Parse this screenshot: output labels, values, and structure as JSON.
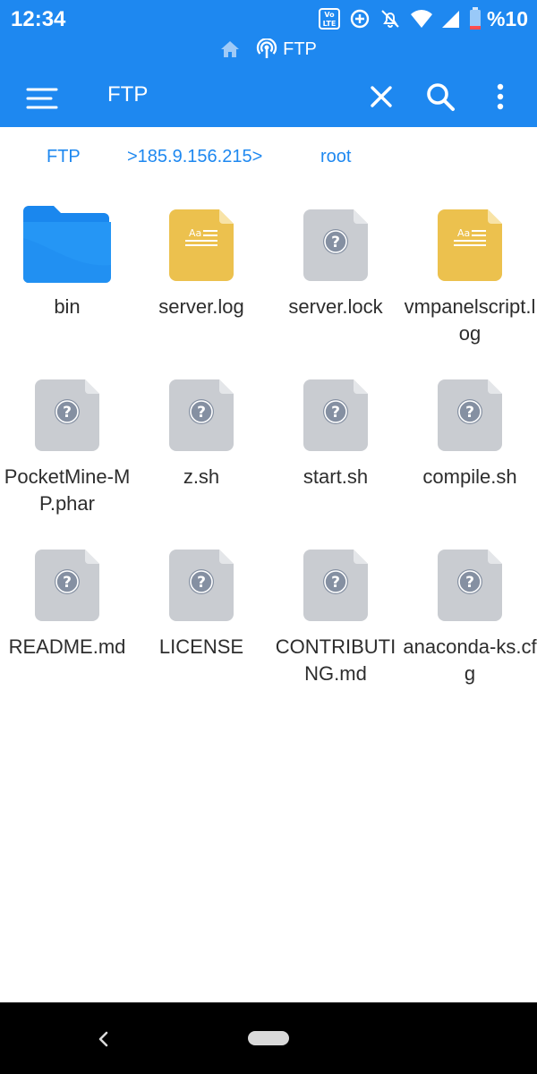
{
  "status_bar": {
    "time": "12:34",
    "battery_text": "%10",
    "sub_label": "FTP"
  },
  "app_bar": {
    "title": "FTP"
  },
  "breadcrumb": {
    "items": [
      "FTP",
      ">185.9.156.215>",
      "root"
    ]
  },
  "files": [
    {
      "name": "bin",
      "type": "folder"
    },
    {
      "name": "server.log",
      "type": "text"
    },
    {
      "name": "server.lock",
      "type": "unknown"
    },
    {
      "name": "vmpanelscript.log",
      "type": "text"
    },
    {
      "name": "PocketMine-MP.phar",
      "type": "unknown"
    },
    {
      "name": "z.sh",
      "type": "unknown"
    },
    {
      "name": "start.sh",
      "type": "unknown"
    },
    {
      "name": "compile.sh",
      "type": "unknown"
    },
    {
      "name": "README.md",
      "type": "unknown"
    },
    {
      "name": "LICENSE",
      "type": "unknown"
    },
    {
      "name": "CONTRIBUTING.md",
      "type": "unknown"
    },
    {
      "name": "anaconda-ks.cfg",
      "type": "unknown"
    }
  ],
  "icons": {
    "folder": "folder-icon",
    "text": "text-file-icon",
    "unknown": "unknown-file-icon"
  },
  "colors": {
    "accent": "#1e88f0",
    "folder": "#1a87ee",
    "text_file": "#ecc14e",
    "unknown_file": "#c9ccd1",
    "badge": "#8590a2"
  },
  "doc_glyph": "Aa",
  "unknown_glyph": "?"
}
